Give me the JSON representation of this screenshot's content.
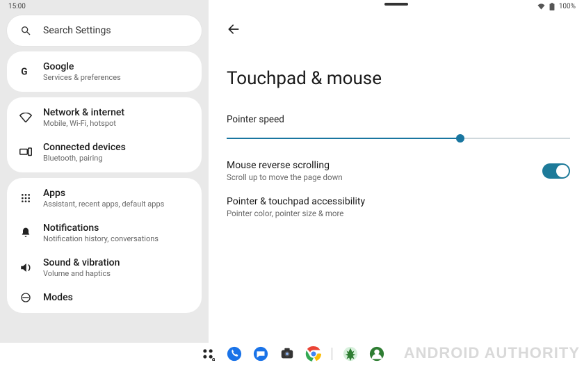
{
  "status": {
    "time": "15:00",
    "battery": "100%"
  },
  "search": {
    "placeholder": "Search Settings"
  },
  "sidebar": {
    "groups": [
      {
        "items": [
          {
            "title": "Google",
            "sub": "Services & preferences",
            "icon": "google"
          }
        ]
      },
      {
        "items": [
          {
            "title": "Network & internet",
            "sub": "Mobile, Wi-Fi, hotspot",
            "icon": "wifi"
          },
          {
            "title": "Connected devices",
            "sub": "Bluetooth, pairing",
            "icon": "devices"
          }
        ]
      },
      {
        "items": [
          {
            "title": "Apps",
            "sub": "Assistant, recent apps, default apps",
            "icon": "apps"
          },
          {
            "title": "Notifications",
            "sub": "Notification history, conversations",
            "icon": "bell"
          },
          {
            "title": "Sound & vibration",
            "sub": "Volume and haptics",
            "icon": "sound"
          },
          {
            "title": "Modes",
            "sub": "",
            "icon": "modes"
          }
        ]
      }
    ]
  },
  "main": {
    "title": "Touchpad & mouse",
    "pointer_speed": {
      "label": "Pointer speed",
      "value_pct": 68
    },
    "reverse": {
      "title": "Mouse reverse scrolling",
      "sub": "Scroll up to move the page down",
      "on": true
    },
    "accessibility": {
      "title": "Pointer & touchpad accessibility",
      "sub": "Pointer color, pointer size & more"
    }
  },
  "watermark": "ANDROID AUTHORITY"
}
